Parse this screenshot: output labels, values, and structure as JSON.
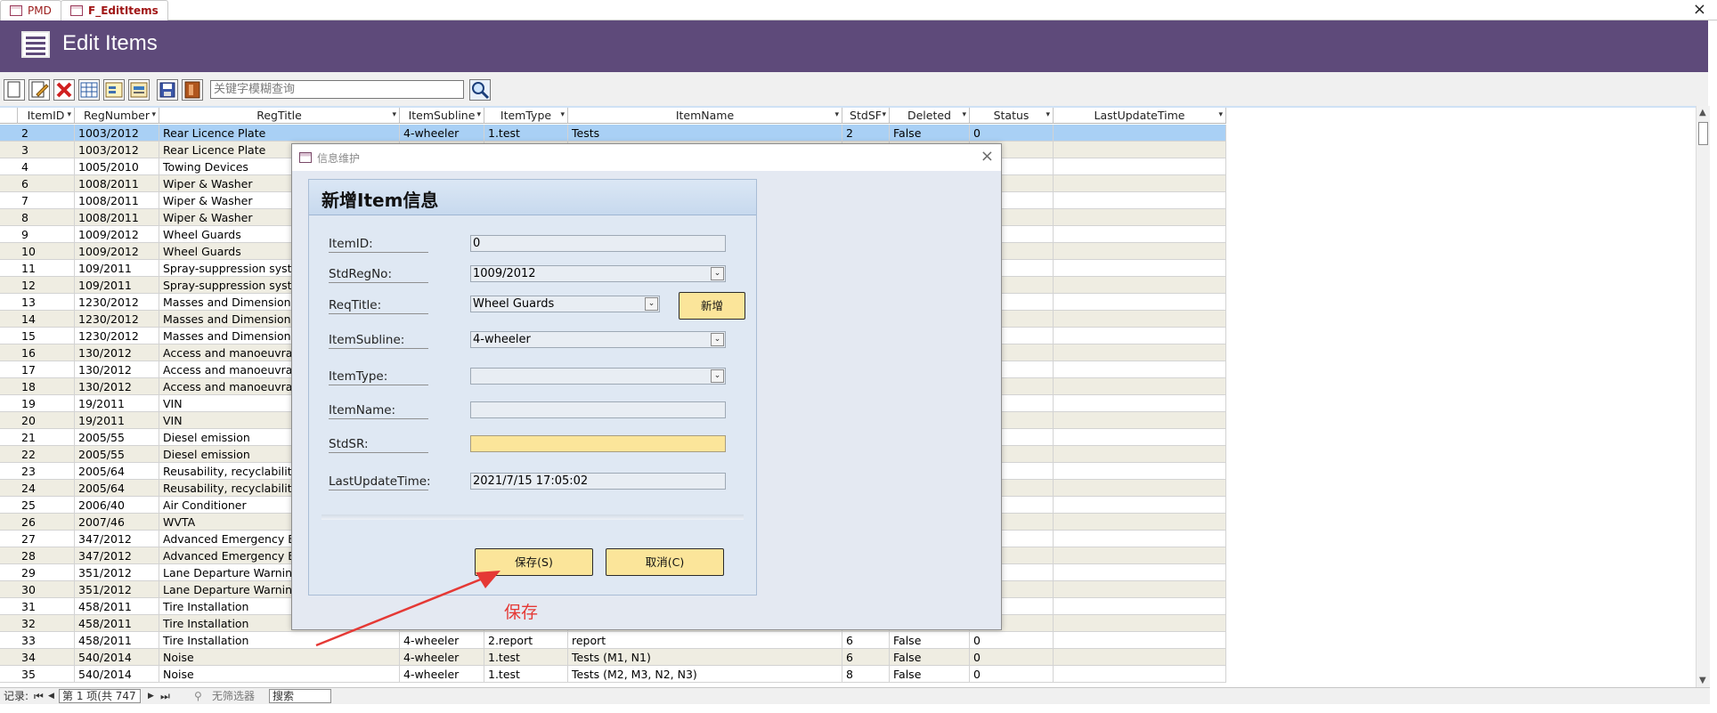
{
  "tabs": [
    {
      "label": "PMD",
      "active": false
    },
    {
      "label": "F_EditItems",
      "active": true
    }
  ],
  "window_close_symbol": "×",
  "banner": {
    "title": "Edit Items",
    "bg_color": "#5e4a7a"
  },
  "toolbar": {
    "buttons": [
      "new-record-icon",
      "edit-record-icon",
      "delete-icon",
      "grid-icon",
      "form-view-icon",
      "report-icon",
      "save-icon",
      "exit-icon"
    ],
    "search_placeholder": "关键字模糊查询",
    "search_button_icon": "magnifier-icon"
  },
  "grid": {
    "columns": [
      "ItemID",
      "RegNumber",
      "RegTitle",
      "ItemSubline",
      "ItemType",
      "ItemName",
      "StdSF",
      "Deleted",
      "Status",
      "LastUpdateTime"
    ],
    "rows": [
      [
        "2",
        "1003/2012",
        "Rear Licence Plate",
        "4-wheeler",
        "1.test",
        "Tests",
        "2",
        "False",
        "0",
        ""
      ],
      [
        "3",
        "1003/2012",
        "Rear Licence Plate",
        "",
        "",
        "",
        "",
        "",
        "",
        ""
      ],
      [
        "4",
        "1005/2010",
        "Towing Devices",
        "",
        "",
        "",
        "",
        "",
        "",
        ""
      ],
      [
        "6",
        "1008/2011",
        "Wiper & Washer",
        "",
        "",
        "",
        "",
        "",
        "",
        ""
      ],
      [
        "7",
        "1008/2011",
        "Wiper & Washer",
        "",
        "",
        "",
        "",
        "",
        "",
        ""
      ],
      [
        "8",
        "1008/2011",
        "Wiper & Washer",
        "",
        "",
        "",
        "",
        "",
        "",
        ""
      ],
      [
        "9",
        "1009/2012",
        "Wheel Guards",
        "",
        "",
        "",
        "",
        "",
        "",
        ""
      ],
      [
        "10",
        "1009/2012",
        "Wheel Guards",
        "",
        "",
        "",
        "",
        "",
        "",
        ""
      ],
      [
        "11",
        "109/2011",
        "Spray-suppression syster",
        "",
        "",
        "",
        "",
        "",
        "",
        ""
      ],
      [
        "12",
        "109/2011",
        "Spray-suppression syster",
        "",
        "",
        "",
        "",
        "",
        "",
        ""
      ],
      [
        "13",
        "1230/2012",
        "Masses and Dimension",
        "",
        "",
        "",
        "",
        "",
        "",
        ""
      ],
      [
        "14",
        "1230/2012",
        "Masses and Dimension",
        "",
        "",
        "",
        "",
        "",
        "",
        ""
      ],
      [
        "15",
        "1230/2012",
        "Masses and Dimension",
        "",
        "",
        "",
        "",
        "",
        "",
        ""
      ],
      [
        "16",
        "130/2012",
        "Access and manoeuvrabi",
        "",
        "",
        "",
        "",
        "",
        "",
        ""
      ],
      [
        "17",
        "130/2012",
        "Access and manoeuvrabi",
        "",
        "",
        "",
        "",
        "",
        "",
        ""
      ],
      [
        "18",
        "130/2012",
        "Access and manoeuvrabi",
        "",
        "",
        "",
        "",
        "",
        "",
        ""
      ],
      [
        "19",
        "19/2011",
        "VIN",
        "",
        "",
        "",
        "",
        "",
        "",
        ""
      ],
      [
        "20",
        "19/2011",
        "VIN",
        "",
        "",
        "",
        "",
        "",
        "",
        ""
      ],
      [
        "21",
        "2005/55",
        "Diesel emission",
        "",
        "",
        "",
        "",
        "",
        "",
        ""
      ],
      [
        "22",
        "2005/55",
        "Diesel emission",
        "",
        "",
        "",
        "",
        "",
        "",
        ""
      ],
      [
        "23",
        "2005/64",
        "Reusability, recyclability, r",
        "",
        "",
        "",
        "",
        "",
        "",
        ""
      ],
      [
        "24",
        "2005/64",
        "Reusability, recyclability, r",
        "",
        "",
        "",
        "",
        "",
        "",
        ""
      ],
      [
        "25",
        "2006/40",
        "Air Conditioner",
        "",
        "",
        "",
        "",
        "",
        "",
        ""
      ],
      [
        "26",
        "2007/46",
        "WVTA",
        "",
        "",
        "",
        "",
        "",
        "",
        ""
      ],
      [
        "27",
        "347/2012",
        "Advanced Emergency Bra",
        "",
        "",
        "",
        "",
        "",
        "",
        ""
      ],
      [
        "28",
        "347/2012",
        "Advanced Emergency Bra",
        "",
        "",
        "",
        "",
        "",
        "",
        ""
      ],
      [
        "29",
        "351/2012",
        "Lane Departure Warning",
        "",
        "",
        "",
        "",
        "",
        "",
        ""
      ],
      [
        "30",
        "351/2012",
        "Lane Departure Warning",
        "",
        "",
        "",
        "",
        "",
        "",
        ""
      ],
      [
        "31",
        "458/2011",
        "Tire Installation",
        "",
        "",
        "",
        "",
        "",
        "",
        ""
      ],
      [
        "32",
        "458/2011",
        "Tire Installation",
        "",
        "",
        "",
        "",
        "",
        "",
        ""
      ],
      [
        "33",
        "458/2011",
        "Tire Installation",
        "4-wheeler",
        "2.report",
        "report",
        "6",
        "False",
        "0",
        ""
      ],
      [
        "34",
        "540/2014",
        "Noise",
        "4-wheeler",
        "1.test",
        "Tests (M1, N1)",
        "6",
        "False",
        "0",
        ""
      ],
      [
        "35",
        "540/2014",
        "Noise",
        "4-wheeler",
        "1.test",
        "Tests (M2, M3, N2, N3)",
        "8",
        "False",
        "0",
        ""
      ]
    ]
  },
  "navbar": {
    "records_label": "记录:",
    "nav_first": "⏮",
    "nav_prev": "◀",
    "record_text": "第 1 项(共 747 项",
    "nav_next": "▶",
    "nav_last": "⏭",
    "filter_label": "无筛选器",
    "search_label": "搜索"
  },
  "dialog": {
    "title": "信息维护",
    "close_symbol": "×",
    "header": "新增Item信息",
    "fields": {
      "item_id": {
        "label": "ItemID:",
        "value": "0"
      },
      "std_reg_no": {
        "label": "StdRegNo:",
        "value": "1009/2012"
      },
      "req_title": {
        "label": "ReqTitle:",
        "value": "Wheel Guards"
      },
      "item_subline": {
        "label": "ItemSubline:",
        "value": "4-wheeler"
      },
      "item_type": {
        "label": "ItemType:",
        "value": ""
      },
      "item_name": {
        "label": "ItemName:",
        "value": ""
      },
      "std_sr": {
        "label": "StdSR:",
        "value": ""
      },
      "last_update_time": {
        "label": "LastUpdateTime:",
        "value": "2021/7/15 17:05:02"
      }
    },
    "add_button": "新增",
    "save_button": "保存(S)",
    "cancel_button": "取消(C)",
    "dropdown_symbol": "⌄"
  },
  "annotation": {
    "text": "保存",
    "color": "#e53935"
  }
}
